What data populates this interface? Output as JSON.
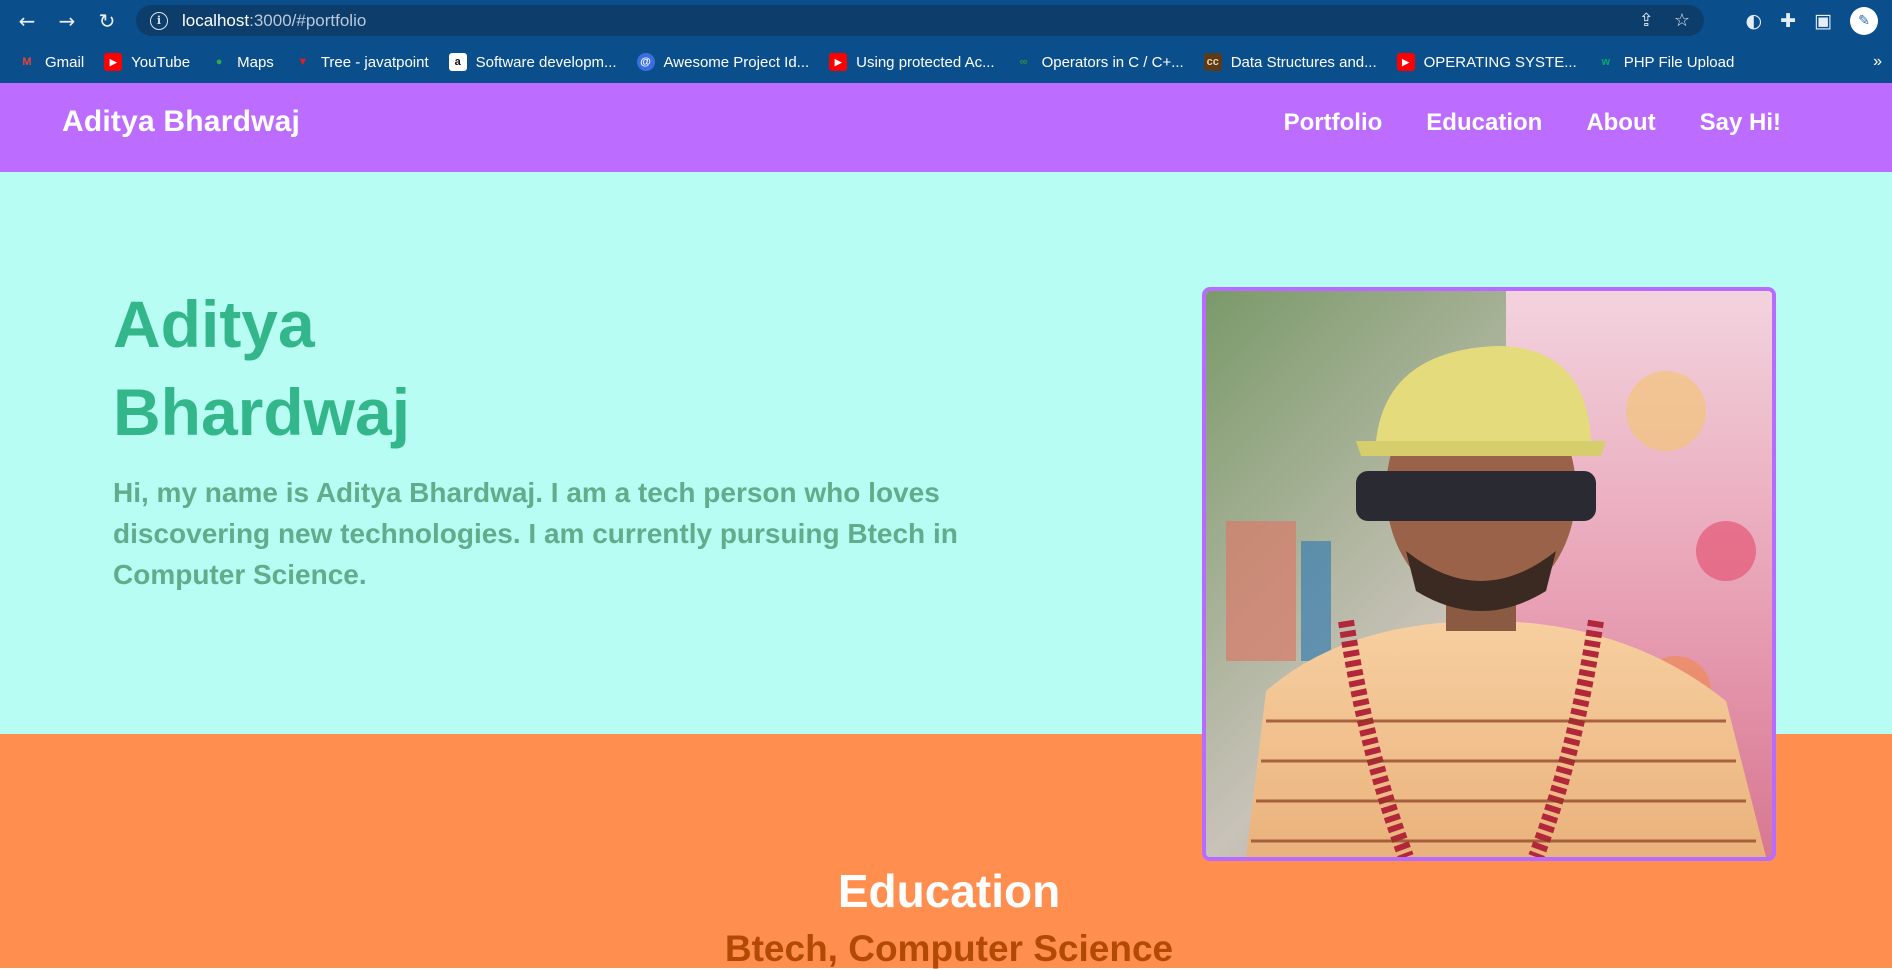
{
  "browser": {
    "url_host": "localhost",
    "url_path": ":3000/#portfolio",
    "nav": {
      "back": "←",
      "forward": "→",
      "reload": "↻"
    }
  },
  "bookmarks": [
    {
      "label": "Gmail",
      "icon": "gmail-icon",
      "color": "#ea4335",
      "glyph": "M"
    },
    {
      "label": "YouTube",
      "icon": "youtube-icon",
      "color": "#ff0000",
      "glyph": "▶"
    },
    {
      "label": "Maps",
      "icon": "maps-icon",
      "color": "#34a853",
      "glyph": "●"
    },
    {
      "label": "Tree - javatpoint",
      "icon": "javatpoint-icon",
      "color": "#e11d1d",
      "glyph": "▼"
    },
    {
      "label": "Software developm...",
      "icon": "amazon-icon",
      "color": "#ffffff",
      "glyph": "a"
    },
    {
      "label": "Awesome Project Id...",
      "icon": "at-sign-icon",
      "color": "#3b6fe0",
      "glyph": "@"
    },
    {
      "label": "Using protected Ac...",
      "icon": "youtube-icon",
      "color": "#ff0000",
      "glyph": "▶"
    },
    {
      "label": "Operators in C / C+...",
      "icon": "geeksforgeeks-icon",
      "color": "#2f8d46",
      "glyph": "∞"
    },
    {
      "label": "Data Structures and...",
      "icon": "cc-icon",
      "color": "#e0b080",
      "glyph": "cc"
    },
    {
      "label": "OPERATING SYSTE...",
      "icon": "youtube-icon",
      "color": "#ff0000",
      "glyph": "▶"
    },
    {
      "label": "PHP File Upload",
      "icon": "w3schools-icon",
      "color": "#04aa6d",
      "glyph": "w"
    }
  ],
  "site": {
    "brand": "Aditya Bhardwaj",
    "nav": [
      "Portfolio",
      "Education",
      "About",
      "Say Hi!"
    ]
  },
  "hero": {
    "name": "Aditya Bhardwaj",
    "bio": "Hi, my name is Aditya Bhardwaj. I am a tech person who loves discovering new technologies. I am currently pursuing Btech in Computer Science."
  },
  "education": {
    "title": "Education",
    "degree": "Btech, Computer Science"
  },
  "colors": {
    "header": "#bc6cff",
    "hero_bg": "#b7fdf4",
    "hero_name": "#33b78a",
    "hero_bio": "#62ac8b",
    "education_bg": "#ff8e4f",
    "degree": "#b24a06"
  }
}
